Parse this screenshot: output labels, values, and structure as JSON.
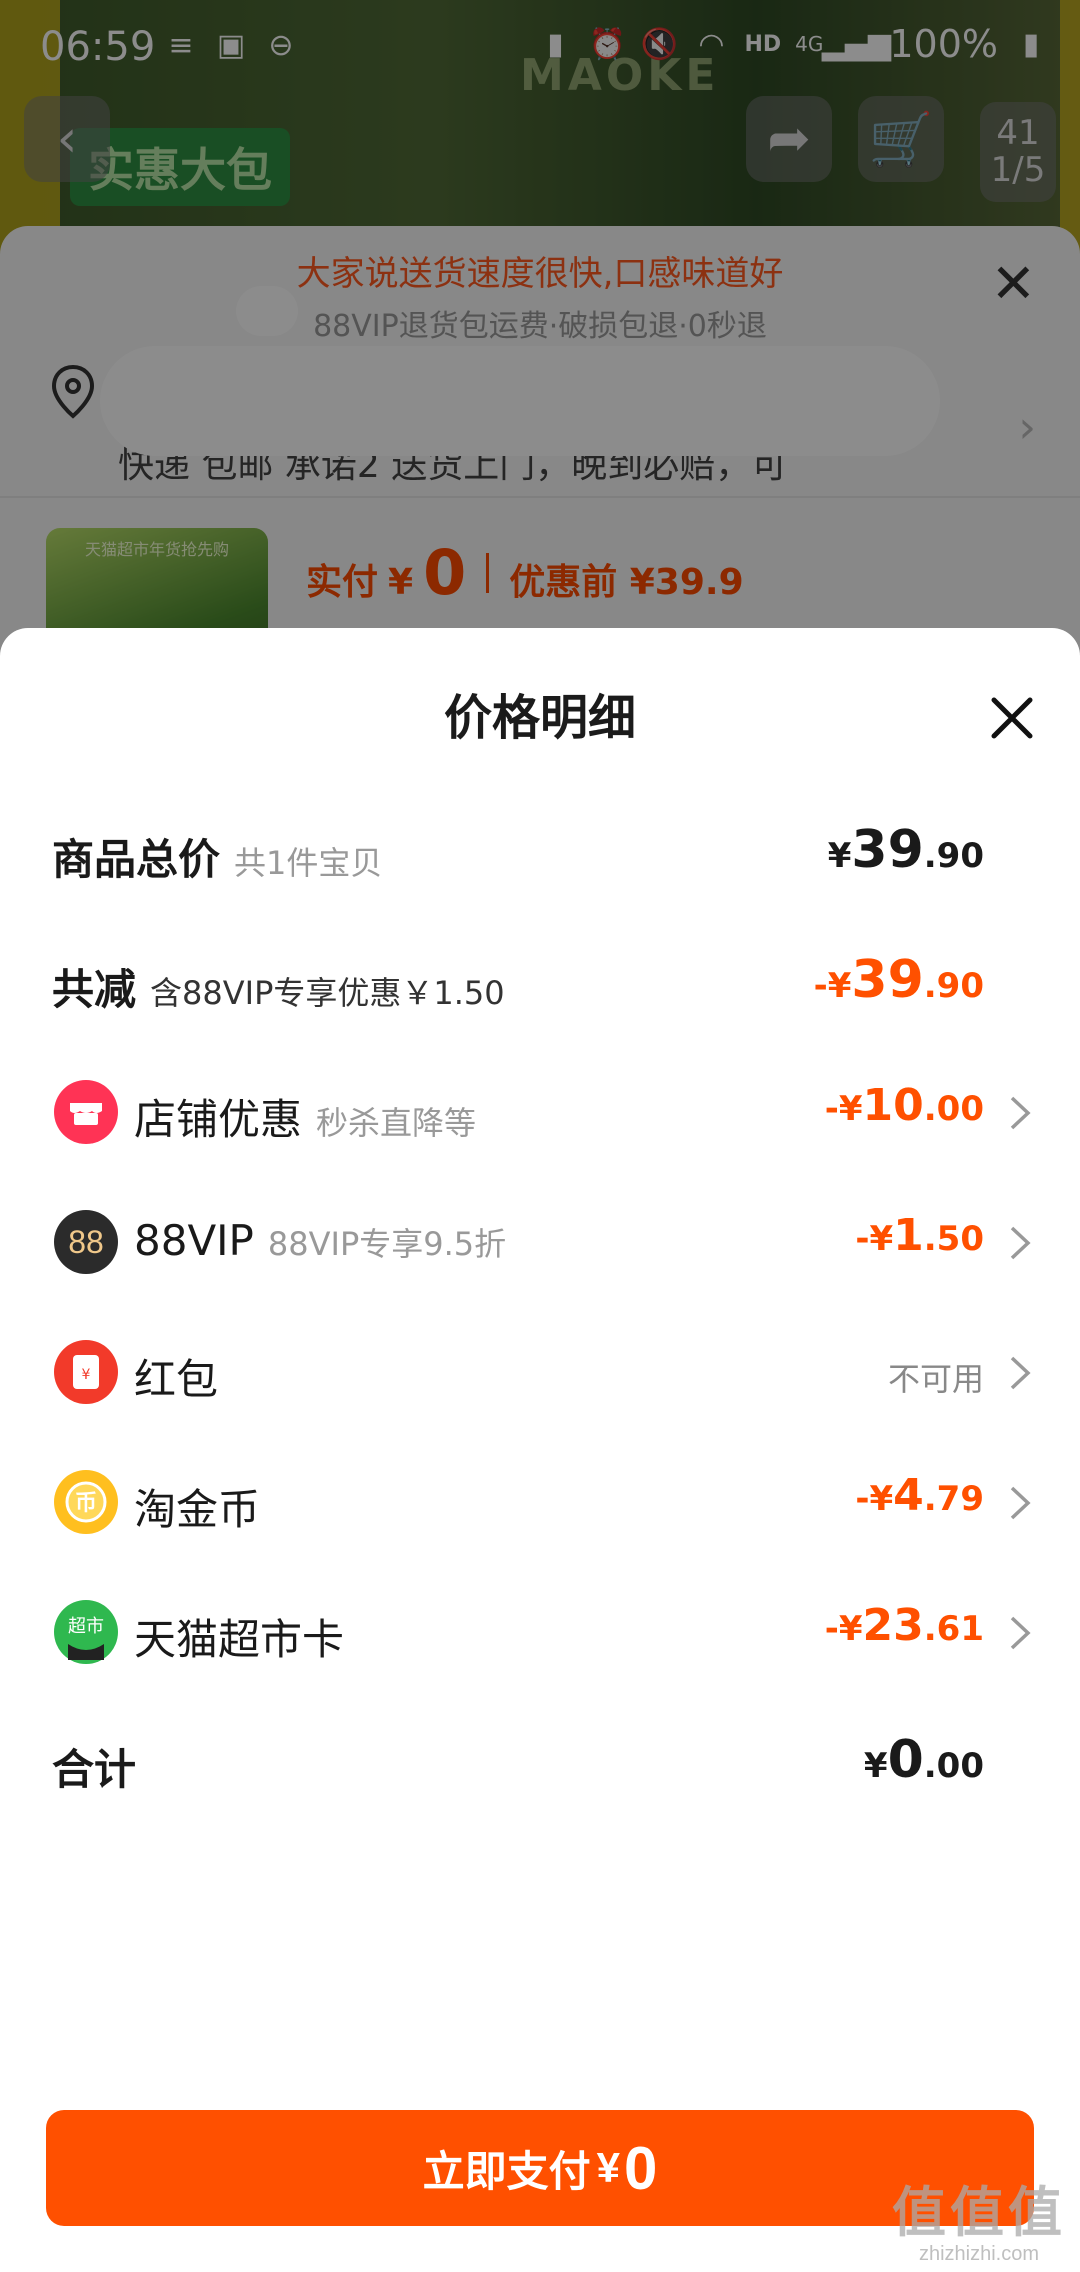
{
  "status_bar": {
    "time": "06:59",
    "network": "HD",
    "signal": "4G",
    "battery": "100%"
  },
  "background_page": {
    "promo_tag": "实惠大包",
    "brand_text": "MAOKE",
    "image_counter": {
      "current": "1/5",
      "badge": "41"
    },
    "banner_line1": "大家说送货速度很快,口感味道好",
    "banner_line2": "88VIP退货包运费·破损包退·0秒退",
    "address_line": "快递 包邮 承诺2  送货上门，晚到必赔，可",
    "thumb_text": "天猫超市年货抢先购",
    "paid_label": "实付",
    "paid_currency": "¥",
    "paid_amount": "0",
    "before_discount": "优惠前 ¥39.9"
  },
  "price_detail": {
    "title": "价格明细",
    "rows": {
      "total": {
        "label": "商品总价",
        "sub": "共1件宝贝",
        "currency": "¥",
        "int": "39",
        "dec": ".90"
      },
      "reduce": {
        "label": "共减",
        "sub": "含88VIP专享优惠￥1.50",
        "currency": "-¥",
        "int": "39",
        "dec": ".90"
      },
      "shop": {
        "label": "店铺优惠",
        "sub": "秒杀直降等",
        "currency": "-¥",
        "int": "10",
        "dec": ".00"
      },
      "vip": {
        "label": "88VIP",
        "sub": "88VIP专享9.5折",
        "currency": "-¥",
        "int": "1",
        "dec": ".50"
      },
      "redpacket": {
        "label": "红包",
        "status": "不可用"
      },
      "coins": {
        "label": "淘金币",
        "currency": "-¥",
        "int": "4",
        "dec": ".79"
      },
      "tmall_card": {
        "label": "天猫超市卡",
        "currency": "-¥",
        "int": "23",
        "dec": ".61"
      },
      "sum": {
        "label": "合计",
        "currency": "¥",
        "int": "0",
        "dec": ".00"
      }
    },
    "pay_button": {
      "label": "立即支付",
      "currency": "¥",
      "amount": "0"
    }
  },
  "watermark": {
    "main": "值值值",
    "site": "zhizhizhi.com"
  },
  "colors": {
    "accent": "#ff5000",
    "text": "#1a1a1a",
    "muted": "#999999"
  },
  "icons": [
    "shop-icon",
    "vip88-icon",
    "red-packet-icon",
    "taojinbi-coin-icon",
    "tmall-card-icon",
    "close-icon",
    "chevron-right-icon",
    "location-pin-icon"
  ]
}
